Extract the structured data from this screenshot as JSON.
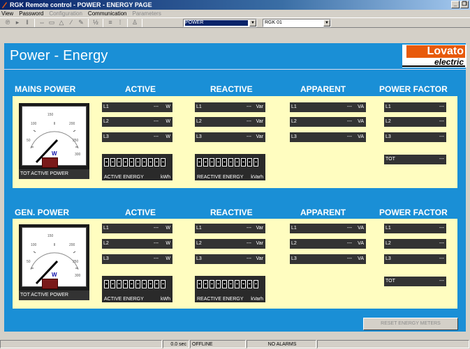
{
  "window": {
    "title": "RGK Remote control - POWER - ENERGY PAGE",
    "minimize": "_",
    "restore": "❐"
  },
  "menu": {
    "items": [
      {
        "label": "View",
        "enabled": true
      },
      {
        "label": "Password",
        "enabled": true
      },
      {
        "label": "Configuration",
        "enabled": false
      },
      {
        "label": "Communication",
        "enabled": true
      },
      {
        "label": "Parameters",
        "enabled": false
      }
    ]
  },
  "toolbar": {
    "page_select": "POWER",
    "device_select": "RGK 01"
  },
  "page": {
    "title": "Power - Energy",
    "logo_top": "Lovato",
    "logo_bottom": "electric"
  },
  "mains": {
    "header": "MAINS POWER",
    "col_active": "ACTIVE",
    "col_reactive": "REACTIVE",
    "col_apparent": "APPARENT",
    "col_pf": "POWER FACTOR",
    "gauge_label": "TOT ACTIVE POWER",
    "gauge_unit": "W",
    "gauge_ticks": [
      "50",
      "100",
      "150",
      "200",
      "250",
      "300"
    ],
    "active": [
      {
        "label": "L1",
        "value": "---",
        "unit": "W"
      },
      {
        "label": "L2",
        "value": "---",
        "unit": "W"
      },
      {
        "label": "L3",
        "value": "---",
        "unit": "W"
      }
    ],
    "reactive": [
      {
        "label": "L1",
        "value": "---",
        "unit": "Var"
      },
      {
        "label": "L2",
        "value": "---",
        "unit": "Var"
      },
      {
        "label": "L3",
        "value": "---",
        "unit": "Var"
      }
    ],
    "apparent": [
      {
        "label": "L1",
        "value": "---",
        "unit": "VA"
      },
      {
        "label": "L2",
        "value": "---",
        "unit": "VA"
      },
      {
        "label": "L3",
        "value": "---",
        "unit": "VA"
      }
    ],
    "pf": [
      {
        "label": "L1",
        "value": "---"
      },
      {
        "label": "L2",
        "value": "---"
      },
      {
        "label": "L3",
        "value": "---"
      }
    ],
    "pf_tot": {
      "label": "TOT",
      "value": "---"
    },
    "active_energy": {
      "label": "ACTIVE ENERGY",
      "unit": "kWh"
    },
    "reactive_energy": {
      "label": "REACTIVE ENERGY",
      "unit": "kVarh"
    }
  },
  "gen": {
    "header": "GEN. POWER",
    "col_active": "ACTIVE",
    "col_reactive": "REACTIVE",
    "col_apparent": "APPARENT",
    "col_pf": "POWER FACTOR",
    "gauge_label": "TOT ACTIVE POWER",
    "gauge_unit": "W",
    "gauge_ticks": [
      "50",
      "100",
      "150",
      "200",
      "250",
      "300"
    ],
    "active": [
      {
        "label": "L1",
        "value": "---",
        "unit": "W"
      },
      {
        "label": "L2",
        "value": "---",
        "unit": "W"
      },
      {
        "label": "L3",
        "value": "---",
        "unit": "W"
      }
    ],
    "reactive": [
      {
        "label": "L1",
        "value": "---",
        "unit": "Var"
      },
      {
        "label": "L2",
        "value": "---",
        "unit": "Var"
      },
      {
        "label": "L3",
        "value": "---",
        "unit": "Var"
      }
    ],
    "apparent": [
      {
        "label": "L1",
        "value": "---",
        "unit": "VA"
      },
      {
        "label": "L2",
        "value": "---",
        "unit": "VA"
      },
      {
        "label": "L3",
        "value": "---",
        "unit": "VA"
      }
    ],
    "pf": [
      {
        "label": "L1",
        "value": "---"
      },
      {
        "label": "L2",
        "value": "---"
      },
      {
        "label": "L3",
        "value": "---"
      }
    ],
    "pf_tot": {
      "label": "TOT",
      "value": "---"
    },
    "active_energy": {
      "label": "ACTIVE ENERGY",
      "unit": "kWh"
    },
    "reactive_energy": {
      "label": "REACTIVE ENERGY",
      "unit": "kVarh"
    }
  },
  "reset_button": "RESET ENERGY METERS",
  "status": {
    "time": "0.0 sec",
    "connection": "OFFLINE",
    "alarms": "NO ALARMS"
  },
  "colors": {
    "background": "#1a8fd6",
    "panel": "#fffdc0",
    "field": "#333333",
    "logo_accent": "#e85a0c"
  }
}
